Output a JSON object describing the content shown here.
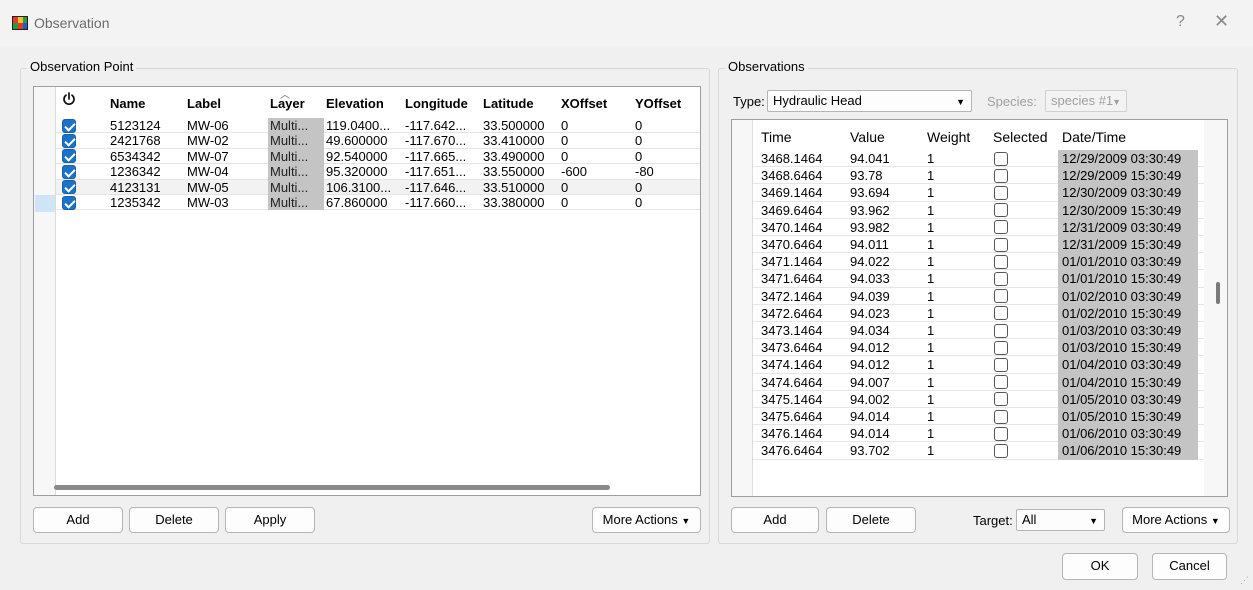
{
  "window": {
    "title": "Observation",
    "help_glyph": "?",
    "close_glyph": "✕"
  },
  "point_group": {
    "title": "Observation Point",
    "columns": [
      "Name",
      "Label",
      "Layer",
      "Elevation",
      "Longitude",
      "Latitude",
      "XOffset",
      "YOffset"
    ],
    "rows": [
      {
        "name": "5123124",
        "label": "MW-06",
        "layer": "Multi...",
        "elevation": "119.0400...",
        "longitude": "-117.642...",
        "latitude": "33.500000",
        "xoffset": "0",
        "yoffset": "0",
        "enabled": true
      },
      {
        "name": "2421768",
        "label": "MW-02",
        "layer": "Multi...",
        "elevation": "49.600000",
        "longitude": "-117.670...",
        "latitude": "33.410000",
        "xoffset": "0",
        "yoffset": "0",
        "enabled": true
      },
      {
        "name": "6534342",
        "label": "MW-07",
        "layer": "Multi...",
        "elevation": "92.540000",
        "longitude": "-117.665...",
        "latitude": "33.490000",
        "xoffset": "0",
        "yoffset": "0",
        "enabled": true
      },
      {
        "name": "1236342",
        "label": "MW-04",
        "layer": "Multi...",
        "elevation": "95.320000",
        "longitude": "-117.651...",
        "latitude": "33.550000",
        "xoffset": "-600",
        "yoffset": "-80",
        "enabled": true
      },
      {
        "name": "4123131",
        "label": "MW-05",
        "layer": "Multi...",
        "elevation": "106.3100...",
        "longitude": "-117.646...",
        "latitude": "33.510000",
        "xoffset": "0",
        "yoffset": "0",
        "enabled": true
      },
      {
        "name": "1235342",
        "label": "MW-03",
        "layer": "Multi...",
        "elevation": "67.860000",
        "longitude": "-117.660...",
        "latitude": "33.380000",
        "xoffset": "0",
        "yoffset": "0",
        "enabled": true
      }
    ],
    "buttons": {
      "add": "Add",
      "delete": "Delete",
      "apply": "Apply",
      "more": "More Actions"
    }
  },
  "obs_group": {
    "title": "Observations",
    "type_label": "Type:",
    "type_value": "Hydraulic Head",
    "species_label": "Species:",
    "species_value": "species #1",
    "columns": [
      "Time",
      "Value",
      "Weight",
      "Selected",
      "Date/Time"
    ],
    "rows": [
      {
        "time": "3468.1464",
        "value": "94.041",
        "weight": "1",
        "datetime": "12/29/2009 03:30:49"
      },
      {
        "time": "3468.6464",
        "value": "93.78",
        "weight": "1",
        "datetime": "12/29/2009 15:30:49"
      },
      {
        "time": "3469.1464",
        "value": "93.694",
        "weight": "1",
        "datetime": "12/30/2009 03:30:49"
      },
      {
        "time": "3469.6464",
        "value": "93.962",
        "weight": "1",
        "datetime": "12/30/2009 15:30:49"
      },
      {
        "time": "3470.1464",
        "value": "93.982",
        "weight": "1",
        "datetime": "12/31/2009 03:30:49"
      },
      {
        "time": "3470.6464",
        "value": "94.011",
        "weight": "1",
        "datetime": "12/31/2009 15:30:49"
      },
      {
        "time": "3471.1464",
        "value": "94.022",
        "weight": "1",
        "datetime": "01/01/2010 03:30:49"
      },
      {
        "time": "3471.6464",
        "value": "94.033",
        "weight": "1",
        "datetime": "01/01/2010 15:30:49"
      },
      {
        "time": "3472.1464",
        "value": "94.039",
        "weight": "1",
        "datetime": "01/02/2010 03:30:49"
      },
      {
        "time": "3472.6464",
        "value": "94.023",
        "weight": "1",
        "datetime": "01/02/2010 15:30:49"
      },
      {
        "time": "3473.1464",
        "value": "94.034",
        "weight": "1",
        "datetime": "01/03/2010 03:30:49"
      },
      {
        "time": "3473.6464",
        "value": "94.012",
        "weight": "1",
        "datetime": "01/03/2010 15:30:49"
      },
      {
        "time": "3474.1464",
        "value": "94.012",
        "weight": "1",
        "datetime": "01/04/2010 03:30:49"
      },
      {
        "time": "3474.6464",
        "value": "94.007",
        "weight": "1",
        "datetime": "01/04/2010 15:30:49"
      },
      {
        "time": "3475.1464",
        "value": "94.002",
        "weight": "1",
        "datetime": "01/05/2010 03:30:49"
      },
      {
        "time": "3475.6464",
        "value": "94.014",
        "weight": "1",
        "datetime": "01/05/2010 15:30:49"
      },
      {
        "time": "3476.1464",
        "value": "94.014",
        "weight": "1",
        "datetime": "01/06/2010 03:30:49"
      },
      {
        "time": "3476.6464",
        "value": "93.702",
        "weight": "1",
        "datetime": "01/06/2010 15:30:49"
      }
    ],
    "buttons": {
      "add": "Add",
      "delete": "Delete",
      "more": "More Actions"
    },
    "target_label": "Target:",
    "target_value": "All"
  },
  "dialog_buttons": {
    "ok": "OK",
    "cancel": "Cancel"
  },
  "colors": {
    "checkbox": "#1a73c8",
    "layer_cell": "#c4c4c4",
    "datetime_cell": "#c4c4c4",
    "grid": "#dcdcdc"
  },
  "icons": {
    "power": "power-icon",
    "sort": "sort-asc-icon"
  }
}
